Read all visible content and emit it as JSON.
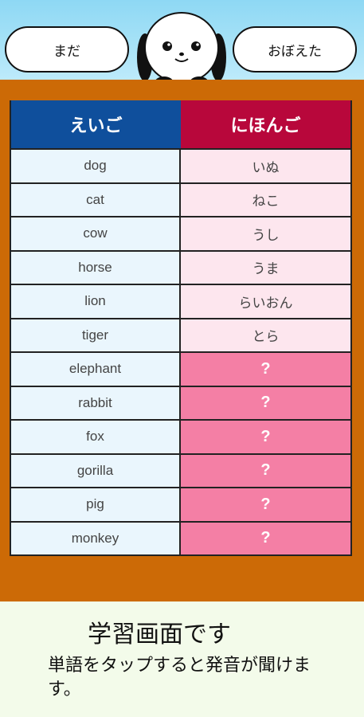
{
  "header": {
    "left_button": "まだ",
    "right_button": "おぼえた"
  },
  "table": {
    "col_en": "えいご",
    "col_ja": "にほんご",
    "rows": [
      {
        "en": "dog",
        "ja": "いぬ",
        "revealed": true
      },
      {
        "en": "cat",
        "ja": "ねこ",
        "revealed": true
      },
      {
        "en": "cow",
        "ja": "うし",
        "revealed": true
      },
      {
        "en": "horse",
        "ja": "うま",
        "revealed": true
      },
      {
        "en": "lion",
        "ja": "らいおん",
        "revealed": true
      },
      {
        "en": "tiger",
        "ja": "とら",
        "revealed": true
      },
      {
        "en": "elephant",
        "ja": "?",
        "revealed": false
      },
      {
        "en": "rabbit",
        "ja": "?",
        "revealed": false
      },
      {
        "en": "fox",
        "ja": "?",
        "revealed": false
      },
      {
        "en": "gorilla",
        "ja": "?",
        "revealed": false
      },
      {
        "en": "pig",
        "ja": "?",
        "revealed": false
      },
      {
        "en": "monkey",
        "ja": "?",
        "revealed": false
      }
    ]
  },
  "info": {
    "title": "学習画面です",
    "body": "単語をタップすると発音が聞けます。"
  },
  "colors": {
    "sky": "#a9e3f7",
    "panel": "#cc6a06",
    "header_en": "#0f4f9c",
    "header_ja": "#b8073b",
    "hidden_cell": "#f47fa5"
  }
}
